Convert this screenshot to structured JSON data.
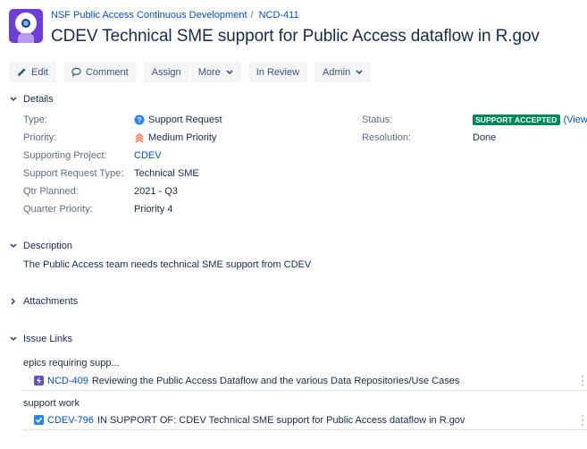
{
  "breadcrumb": {
    "project": "NSF Public Access Continuous Development",
    "separator": "/",
    "issue_key": "NCD-411"
  },
  "issue": {
    "title": "CDEV Technical SME support for Public Access dataflow in R.gov"
  },
  "toolbar": {
    "edit": "Edit",
    "comment": "Comment",
    "assign": "Assign",
    "more": "More",
    "in_review": "In Review",
    "admin": "Admin"
  },
  "details": {
    "heading": "Details",
    "left": [
      {
        "label": "Type:",
        "value": "Support Request",
        "icon": "support-request-icon"
      },
      {
        "label": "Priority:",
        "value": "Medium Priority",
        "icon": "medium-priority-icon"
      },
      {
        "label": "Supporting Project:",
        "value": "CDEV"
      },
      {
        "label": "Support Request Type:",
        "value": "Technical SME"
      },
      {
        "label": "Qtr Planned:",
        "value": "2021 - Q3"
      },
      {
        "label": "Quarter Priority:",
        "value": "Priority 4"
      }
    ],
    "right": {
      "status_label": "Status:",
      "status_value": "SUPPORT ACCEPTED",
      "status_link": "(View W",
      "resolution_label": "Resolution:",
      "resolution_value": "Done"
    }
  },
  "description": {
    "heading": "Description",
    "text": "The Public Access team needs technical SME support from CDEV"
  },
  "attachments": {
    "heading": "Attachments"
  },
  "issue_links": {
    "heading": "Issue Links",
    "groups": [
      {
        "title": "epics requiring supp...",
        "key": "NCD-409",
        "summary": "Reviewing the Public Access Dataflow and the various Data Repositories/Use Cases",
        "icon": "epic-icon"
      },
      {
        "title": "support work",
        "key": "CDEV-796",
        "summary": "IN SUPPORT OF: CDEV Technical SME support for Public Access dataflow in R.gov",
        "icon": "task-icon"
      }
    ]
  },
  "colors": {
    "link": "#0052cc",
    "text": "#172b4d",
    "label": "#5e6c84",
    "status_green": "#00875a",
    "epic_purple": "#6554c0",
    "task_blue": "#2684ff",
    "button_bg": "#f4f5f7"
  }
}
